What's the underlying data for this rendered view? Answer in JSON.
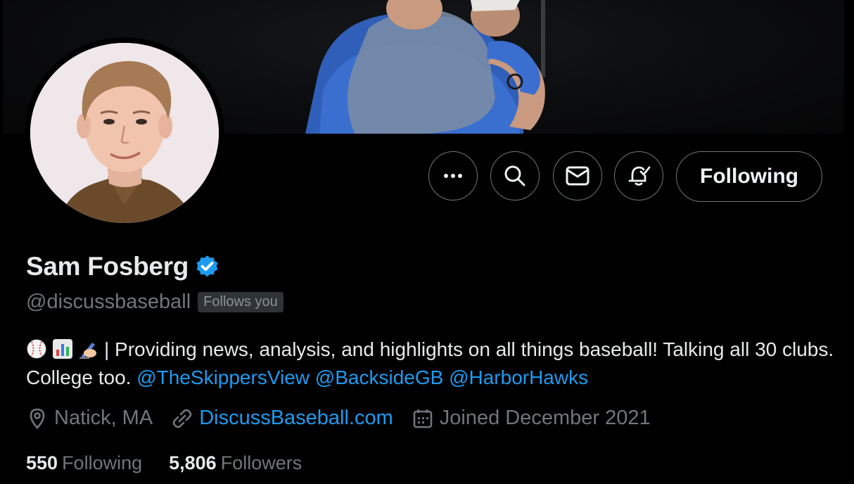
{
  "profile": {
    "name": "Sam Fosberg",
    "handle": "@discussbaseball",
    "follows_you": "Follows you",
    "verified": true
  },
  "actions": {
    "more_icon": "more-horizontal-icon",
    "search_icon": "search-icon",
    "message_icon": "envelope-icon",
    "notify_icon": "bell-check-icon",
    "follow_label": "Following"
  },
  "bio": {
    "emojis": [
      "baseball",
      "bar-chart",
      "writing-hand"
    ],
    "text": "| Providing news, analysis, and highlights on all things baseball! Talking all 30 clubs. College too. ",
    "mentions": [
      "@TheSkippersView",
      "@BacksideGB",
      "@HarborHawks"
    ]
  },
  "meta": {
    "location": "Natick, MA",
    "website": "DiscussBaseball.com",
    "joined": "Joined December 2021"
  },
  "stats": {
    "following_count": "550",
    "following_label": "Following",
    "followers_count": "5,806",
    "followers_label": "Followers"
  },
  "colors": {
    "accent": "#1d9bf0",
    "background": "#000000",
    "secondary_text": "#71767b",
    "primary_text": "#e7e9ea"
  }
}
